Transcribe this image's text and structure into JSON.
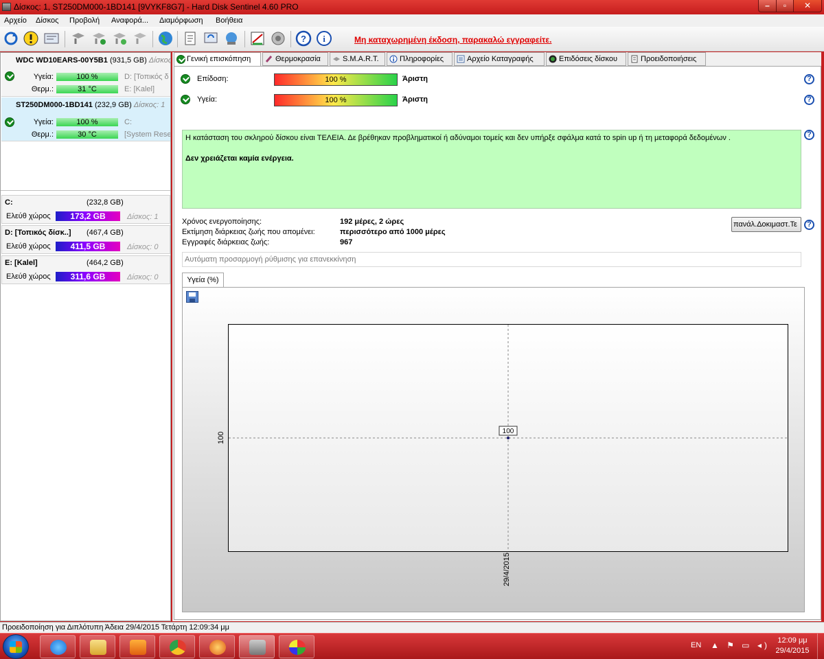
{
  "window": {
    "title": "Δίσκος: 1, ST250DM000-1BD141 [9VYKF8G7]  -  Hard Disk Sentinel 4.60 PRO",
    "controls": [
      "minimize",
      "maximize",
      "close"
    ]
  },
  "menu": [
    "Αρχείο",
    "Δίσκος",
    "Προβολή",
    "Αναφορά...",
    "Διαμόρφωση",
    "Βοήθεια"
  ],
  "toolbar": {
    "icons": [
      "refresh-icon",
      "warning-icon",
      "report-icon",
      "disk-icon",
      "disk-check-icon",
      "disk-test-icon",
      "disk-tools-icon",
      "globe-icon",
      "document-icon",
      "sync-icon",
      "network-icon",
      "performance-icon",
      "sound-icon",
      "help-icon",
      "info-icon"
    ],
    "register_link": "Μη καταχωρημένη έκδοση, παρακαλώ εγγραφείτε."
  },
  "disks": [
    {
      "name": "WDC WD10EARS-00Y5B1",
      "size": "(931,5 GB)",
      "index": "Δίσκος",
      "health_label": "Υγεία:",
      "health": "100 %",
      "temp_label": "Θερμ.:",
      "temp": "31 °C",
      "vol1": "D: [Τοπικός δ",
      "vol2": "E: [Kalel]",
      "selected": false
    },
    {
      "name": "ST250DM000-1BD141",
      "size": "(232,9 GB)",
      "index": "Δίσκος: 1",
      "health_label": "Υγεία:",
      "health": "100 %",
      "temp_label": "Θερμ.:",
      "temp": "30 °C",
      "vol1": "C:",
      "vol2": "[System Rese",
      "selected": true
    }
  ],
  "volumes": [
    {
      "name": "C:",
      "size": "(232,8 GB)",
      "free_label": "Ελεύθ χώρος",
      "free": "173,2 GB",
      "disk": "Δίσκος: 1"
    },
    {
      "name": "D: [Τοπικός δίσκ..]",
      "size": "(467,4 GB)",
      "free_label": "Ελεύθ χώρος",
      "free": "411,5 GB",
      "disk": "Δίσκος: 0"
    },
    {
      "name": "E: [Kalel]",
      "size": "(464,2 GB)",
      "free_label": "Ελεύθ χώρος",
      "free": "311,6 GB",
      "disk": "Δίσκος: 0"
    }
  ],
  "tabs": [
    {
      "label": "Γενική επισκόπηση",
      "icon": "check-icon",
      "active": true
    },
    {
      "label": "Θερμοκρασία",
      "icon": "thermometer-icon",
      "active": false
    },
    {
      "label": "S.M.A.R.T.",
      "icon": "smart-icon",
      "active": false
    },
    {
      "label": "Πληροφορίες",
      "icon": "info-icon",
      "active": false
    },
    {
      "label": "Αρχείο Καταγραφής",
      "icon": "log-icon",
      "active": false
    },
    {
      "label": "Επιδόσεις δίσκου",
      "icon": "gauge-icon",
      "active": false
    },
    {
      "label": "Προειδοποιήσεις",
      "icon": "alerts-icon",
      "active": false
    }
  ],
  "overview": {
    "performance_label": "Επίδοση:",
    "performance_value": "100 %",
    "performance_text": "Άριστη",
    "health_label": "Υγεία:",
    "health_value": "100 %",
    "health_text": "Άριστη",
    "status_text": "Η κατάσταση του σκληρού δίσκου είναι ΤΕΛΕΙΑ. Δε βρέθηκαν προβληματικοί ή αδύναμοι τομείς και δεν υπήρξε σφάλμα κατά το spin up ή τη μεταφορά δεδομένων .",
    "action_text": "Δεν χρειάζεται καμία ενέργεια.",
    "power_on_label": "Χρόνος ενεργοποίησης:",
    "power_on_value": "192 μέρες, 2 ώρες",
    "remaining_label": "Εκτίμηση διάρκειας ζωής που απομένει:",
    "remaining_value": "περισσότερο από 1000 μέρες",
    "lifetime_writes_label": "Εγγραφές διάρκειας ζωής:",
    "lifetime_writes_value": "967",
    "life_button": "πανάλ.Δοκιμαστ.Τε",
    "auto_text": "Αυτόματη προσαρμογή ρύθμισης για επανεκκίνηση",
    "chart_tab": "Υγεία (%)"
  },
  "chart_data": {
    "type": "line",
    "x": [
      "29/4/2015"
    ],
    "series": [
      {
        "values": [
          100
        ]
      }
    ],
    "data_labels": [
      "100"
    ],
    "ytick_labels": [
      "100"
    ],
    "xtick_labels": [
      "29/4/2015"
    ],
    "grid": true
  },
  "statusbar": {
    "text": "Προειδοποίηση για Διπλότυπη  Άδεια 29/4/2015 Τετάρτη 12:09:34 μμ"
  },
  "taskbar": {
    "apps": [
      "internet-explorer-icon",
      "file-explorer-icon",
      "media-player-icon",
      "chrome-icon",
      "firefox-icon",
      "hdsentinel-icon",
      "paint-icon"
    ],
    "lang": "EN",
    "time": "12:09 μμ",
    "date": "29/4/2015"
  },
  "colors": {
    "title_bar": "#c61d1d",
    "register_link": "#e00000",
    "status_ok_bg": "#c0ffbe",
    "taskbar": "#b8191b"
  }
}
